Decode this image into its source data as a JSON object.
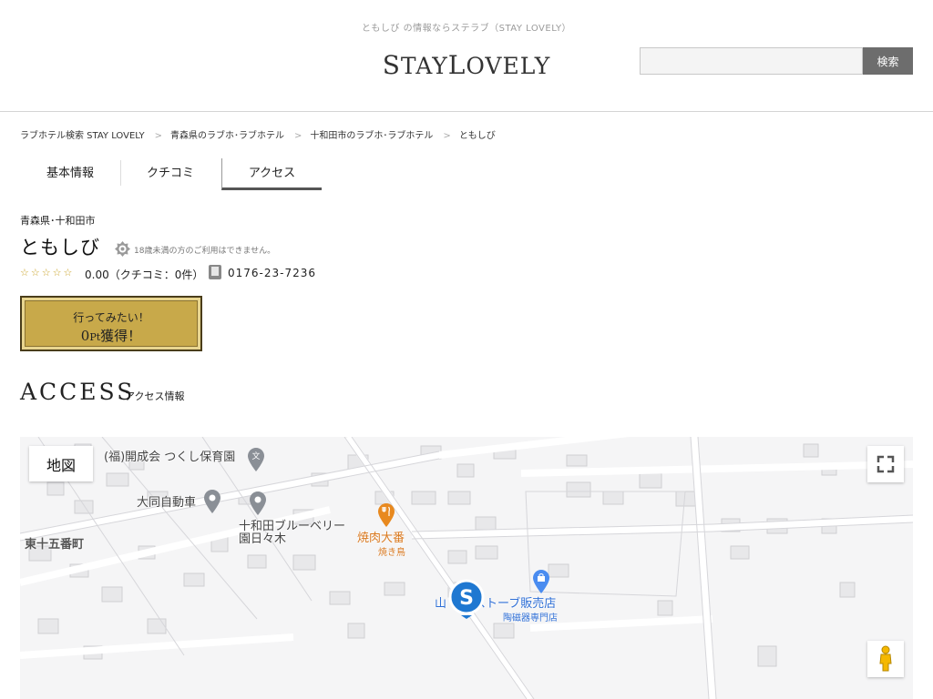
{
  "header": {
    "tagline": "ともしび の情報ならステラブ（STAY LOVELY）",
    "logo_s": "S",
    "logo_tay": "TAY",
    "logo_l": "L",
    "logo_ovely": "OVELY",
    "search_value": "",
    "search_button": "検索"
  },
  "breadcrumb": {
    "items": [
      "ラブホテル検索 STAY LOVELY",
      "青森県のラブホ･ラブホテル",
      "十和田市のラブホ･ラブホテル",
      "ともしび"
    ],
    "separator": ">"
  },
  "tabs": [
    "基本情報",
    "クチコミ",
    "アクセス"
  ],
  "hotel": {
    "prefecture_city": "青森県･十和田市",
    "name": "ともしび",
    "age_note": "18歳未満の方のご利用はできません。",
    "stars": "☆☆☆☆☆",
    "rating": "0.00（クチコミ：0件）",
    "phone": "0176-23-7236"
  },
  "want_button": {
    "line1": "行ってみたい！",
    "points": "0",
    "pt": "Pt",
    "suffix": "獲得！"
  },
  "access": {
    "title": "ACCESS",
    "subtitle": "アクセス情報"
  },
  "map": {
    "type_button": "地図",
    "labels": {
      "nursery": "(福)開成会 つくし保育園",
      "auto": "大同自動車",
      "blueberry1": "十和田ブルーベリー",
      "blueberry2": "園日々木",
      "yakiniku": "焼肉大番",
      "yakiniku_sub": "焼き鳥",
      "district": "東十五番町",
      "stove": "山",
      "stove2": "ストーブ販売店",
      "stove_sub": "陶磁器専門店"
    },
    "colors": {
      "orange": "#d9781e",
      "blue": "#2f6fd6",
      "pin_grey": "#8a8f96"
    }
  }
}
